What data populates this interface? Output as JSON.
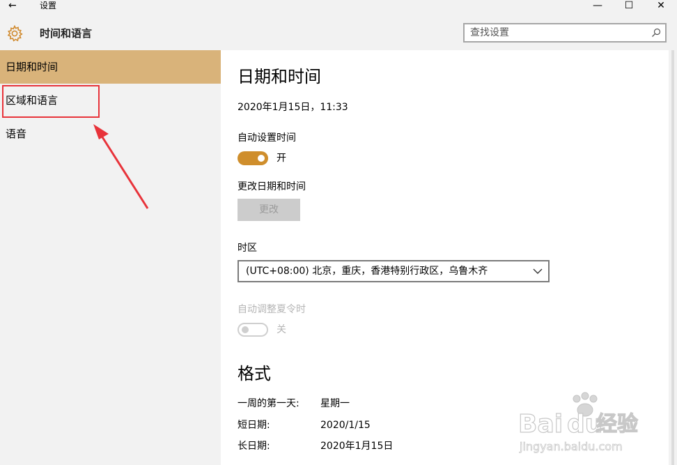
{
  "window": {
    "title": "设置",
    "back_glyph": "←",
    "minimize_glyph": "—",
    "maximize_glyph": "☐",
    "close_glyph": "✕"
  },
  "header": {
    "icon": "gear-icon",
    "title": "时间和语言",
    "search_placeholder": "查找设置"
  },
  "sidebar": {
    "items": [
      {
        "label": "日期和时间",
        "active": true
      },
      {
        "label": "区域和语言",
        "active": false
      },
      {
        "label": "语音",
        "active": false
      }
    ]
  },
  "main": {
    "title": "日期和时间",
    "current_datetime": "2020年1月15日，11:33",
    "auto_time_label": "自动设置时间",
    "auto_time_state": "开",
    "change_section_label": "更改日期和时间",
    "change_button": "更改",
    "timezone_label": "时区",
    "timezone_value": "(UTC+08:00) 北京，重庆，香港特别行政区，乌鲁木齐",
    "dst_label": "自动调整夏令时",
    "dst_state": "关",
    "format_title": "格式",
    "formats": [
      {
        "label": "一周的第一天:",
        "value": "星期一"
      },
      {
        "label": "短日期:",
        "value": "2020/1/15"
      },
      {
        "label": "长日期:",
        "value": "2020年1月15日"
      }
    ]
  },
  "colors": {
    "accent": "#cf8e2c",
    "sidebar_active": "#d9b37a",
    "highlight_box": "#e8333a"
  },
  "watermark": {
    "brand": "Baidu",
    "brand_cn": "经验",
    "url": "jingyan.baidu.com"
  }
}
